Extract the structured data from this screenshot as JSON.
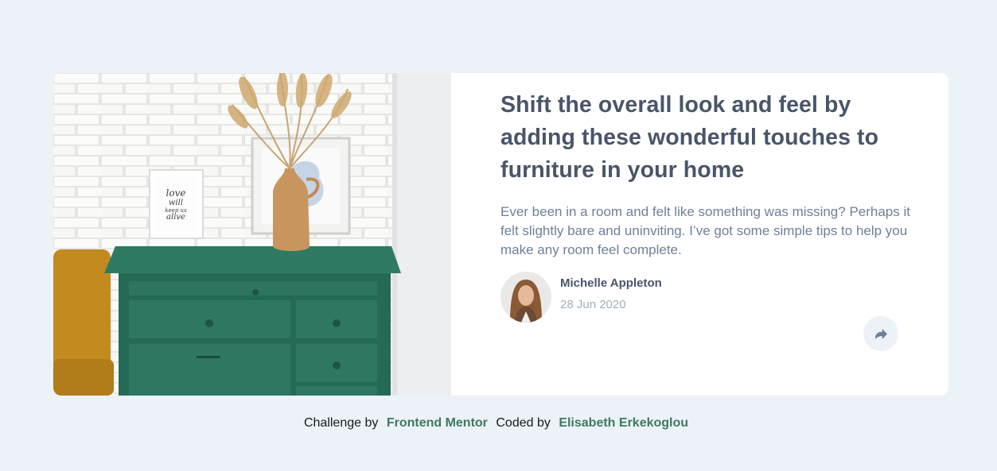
{
  "article": {
    "title": "Shift the overall look and feel by adding these wonderful touches to furniture in your home",
    "description": "Ever been in a room and felt like something was missing? Perhaps it felt slightly bare and uninviting. I’ve got some simple tips to help you make any room feel complete."
  },
  "author": {
    "name": "Michelle Appleton",
    "date": "28 Jun 2020"
  },
  "photo": {
    "sign_text": [
      "love",
      "will",
      "keep us",
      "alive"
    ]
  },
  "share": {
    "icon": "share-icon"
  },
  "attribution": {
    "challenge_prefix": "Challenge by",
    "challenge_link": "Frontend Mentor",
    "coded_prefix": "Coded by",
    "coded_link": "Elisabeth Erkekoglou"
  },
  "colors": {
    "page_background": "#ecf2f8",
    "title": "#48556a",
    "body_text": "#6e8098",
    "muted": "#9daec2",
    "link": "#3e7a5f"
  }
}
